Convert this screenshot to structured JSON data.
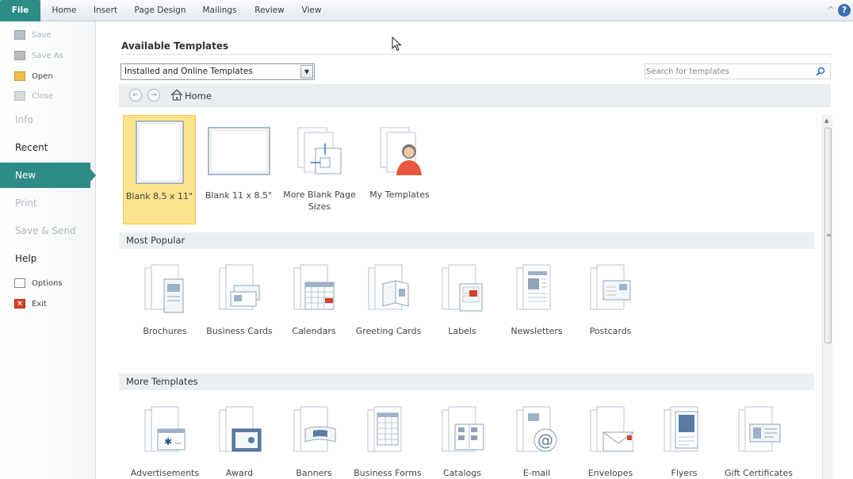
{
  "ribbon": {
    "tabs": [
      "File",
      "Home",
      "Insert",
      "Page Design",
      "Mailings",
      "Review",
      "View"
    ],
    "help": "?"
  },
  "nav": {
    "save": "Save",
    "save_as": "Save As",
    "open": "Open",
    "close": "Close",
    "info": "Info",
    "recent": "Recent",
    "new": "New",
    "print": "Print",
    "save_send": "Save & Send",
    "help": "Help",
    "options": "Options",
    "exit": "Exit"
  },
  "main": {
    "heading": "Available Templates",
    "dropdown_value": "Installed and Online Templates",
    "search_placeholder": "Search for templates",
    "breadcrumb": "Home"
  },
  "blank_templates": [
    {
      "label": "Blank 8.5 x 11\"",
      "icon": "blank-portrait-icon"
    },
    {
      "label": "Blank 11 x 8.5\"",
      "icon": "blank-landscape-icon"
    },
    {
      "label": "More Blank Page Sizes",
      "icon": "page-sizes-icon"
    },
    {
      "label": "My Templates",
      "icon": "my-templates-icon"
    }
  ],
  "most_popular": {
    "title": "Most Popular",
    "items": [
      "Brochures",
      "Business Cards",
      "Calendars",
      "Greeting Cards",
      "Labels",
      "Newsletters",
      "Postcards"
    ]
  },
  "more_templates": {
    "title": "More Templates",
    "items": [
      "Advertisements",
      "Award",
      "Banners",
      "Business Forms",
      "Catalogs",
      "E-mail",
      "Envelopes",
      "Flyers",
      "Gift Certificates"
    ]
  },
  "colors": {
    "accent": "#2d8c86",
    "selected_tile": "#fde28d"
  }
}
